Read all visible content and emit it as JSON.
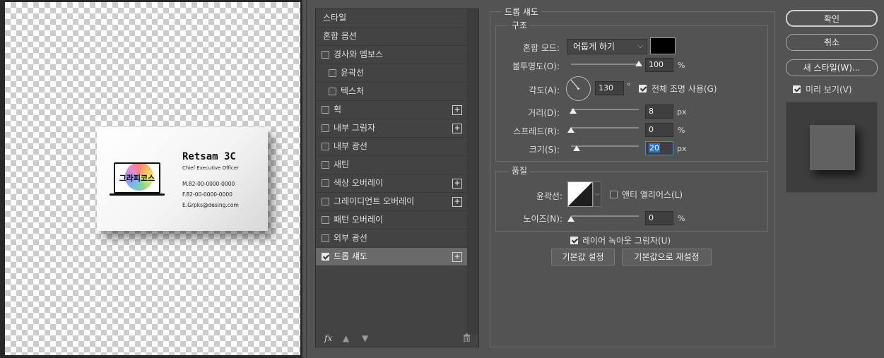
{
  "card": {
    "name": "Retsam 3C",
    "role": "Chief Executive Officer",
    "logo_text": "그라피코스",
    "phone": "M.82-00-0000-0000",
    "fax": "F.82-00-0000-0000",
    "email": "E.Grpks@desing.com"
  },
  "style_list": {
    "items": [
      {
        "label": "스타일",
        "checkbox": false,
        "checked": false,
        "plus": false,
        "indent": false,
        "selected": false
      },
      {
        "label": "혼합 옵션",
        "checkbox": false,
        "checked": false,
        "plus": false,
        "indent": false,
        "selected": false
      },
      {
        "label": "경사와 엠보스",
        "checkbox": true,
        "checked": false,
        "plus": false,
        "indent": false,
        "selected": false
      },
      {
        "label": "윤곽선",
        "checkbox": true,
        "checked": false,
        "plus": false,
        "indent": true,
        "selected": false
      },
      {
        "label": "텍스처",
        "checkbox": true,
        "checked": false,
        "plus": false,
        "indent": true,
        "selected": false
      },
      {
        "label": "획",
        "checkbox": true,
        "checked": false,
        "plus": true,
        "indent": false,
        "selected": false
      },
      {
        "label": "내부 그림자",
        "checkbox": true,
        "checked": false,
        "plus": true,
        "indent": false,
        "selected": false
      },
      {
        "label": "내부 광선",
        "checkbox": true,
        "checked": false,
        "plus": false,
        "indent": false,
        "selected": false
      },
      {
        "label": "새틴",
        "checkbox": true,
        "checked": false,
        "plus": false,
        "indent": false,
        "selected": false
      },
      {
        "label": "색상 오버레이",
        "checkbox": true,
        "checked": false,
        "plus": true,
        "indent": false,
        "selected": false
      },
      {
        "label": "그레이디언트 오버레이",
        "checkbox": true,
        "checked": false,
        "plus": true,
        "indent": false,
        "selected": false
      },
      {
        "label": "패턴 오버레이",
        "checkbox": true,
        "checked": false,
        "plus": false,
        "indent": false,
        "selected": false
      },
      {
        "label": "외부 광선",
        "checkbox": true,
        "checked": false,
        "plus": false,
        "indent": false,
        "selected": false
      },
      {
        "label": "드롭 섀도",
        "checkbox": true,
        "checked": true,
        "plus": true,
        "indent": false,
        "selected": true
      }
    ],
    "footer_icons": [
      "fx-icon",
      "arrow-up-icon",
      "arrow-down-icon",
      "trash-icon"
    ],
    "fx_label": "fx"
  },
  "drop_shadow": {
    "title": "드롭 섀도",
    "structure": {
      "title": "구조",
      "blend_mode_label": "혼합 모드:",
      "blend_mode_value": "어둡게 하기",
      "shadow_color": "#000000",
      "opacity_label": "불투명도(O):",
      "opacity_value": "100",
      "opacity_unit": "%",
      "opacity_level": 1.0,
      "angle_label": "각도(A):",
      "angle_value": "130",
      "angle_unit": "°",
      "global_light_label": "전체 조명 사용(G)",
      "global_light_checked": true,
      "distance_label": "거리(D):",
      "distance_value": "8",
      "distance_unit": "px",
      "distance_level": 0.03,
      "spread_label": "스프레드(R):",
      "spread_value": "0",
      "spread_unit": "%",
      "spread_level": 0.0,
      "size_label": "크기(S):",
      "size_value": "20",
      "size_unit": "px",
      "size_level": 0.08
    },
    "quality": {
      "title": "품질",
      "contour_label": "윤곽선:",
      "anti_alias_label": "앤티 앨리어스(L)",
      "anti_alias_checked": false,
      "noise_label": "노이즈(N):",
      "noise_value": "0",
      "noise_unit": "%",
      "noise_level": 0.0
    },
    "knockout_label": "레이어 녹아웃 그림자(U)",
    "knockout_checked": true,
    "make_default_label": "기본값 설정",
    "reset_default_label": "기본값으로 재설정"
  },
  "buttons": {
    "ok": "확인",
    "cancel": "취소",
    "new_style": "새 스타일(W)...",
    "preview_label": "미리 보기(V)",
    "preview_checked": true
  }
}
